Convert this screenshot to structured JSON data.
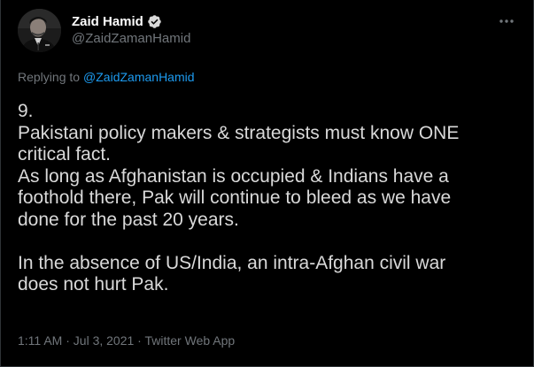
{
  "author": {
    "display_name": "Zaid Hamid",
    "handle": "@ZaidZamanHamid",
    "verified": true,
    "verified_color": "#1d9bf0",
    "avatar_icon": "profile-photo"
  },
  "reply": {
    "prefix": "Replying to",
    "mention": "@ZaidZamanHamid"
  },
  "tweet": {
    "lines": [
      "9.",
      "Pakistani policy makers & strategists must know ONE",
      "critical fact.",
      "As long as Afghanistan is occupied & Indians have a",
      "foothold there, Pak will continue to bleed as we have",
      "done for the past 20 years.",
      "",
      "In the absence of US/India, an intra-Afghan civil war",
      "does not hurt Pak."
    ]
  },
  "meta": {
    "time": "1:11 AM",
    "separator": "·",
    "date": "Jul 3, 2021",
    "source": "Twitter Web App"
  },
  "icons": {
    "more": "more-dots-icon"
  },
  "colors": {
    "background": "#000000",
    "text": "#d9d9d9",
    "secondary": "#71767b",
    "link": "#1d9bf0"
  }
}
